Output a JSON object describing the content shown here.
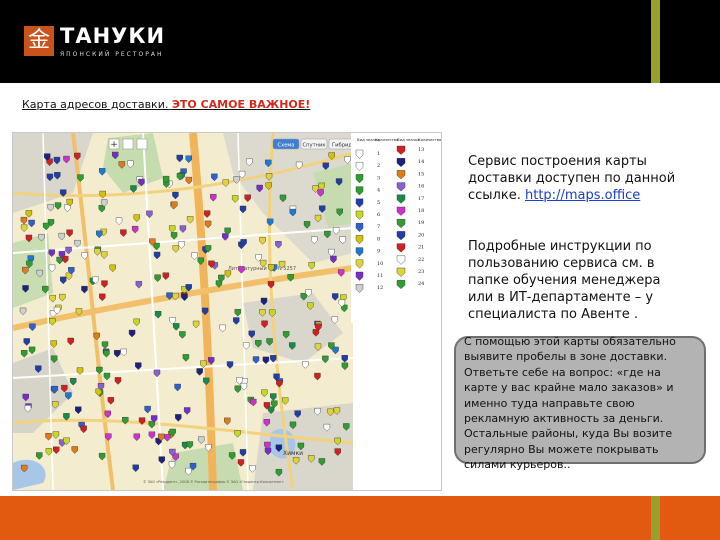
{
  "logo": {
    "name": "ТАНУКИ",
    "subtitle": "ЯПОНСКИЙ РЕСТОРАН",
    "glyph": "金"
  },
  "colors": {
    "header_bg": "#000000",
    "accent_bar": "#97a02a",
    "footer_bar": "#e15a0f",
    "logo_box": "#c9531b",
    "highlight": "#d42a1a",
    "link": "#1a3fc9"
  },
  "caption": {
    "text": "Карта адресов доставки.",
    "highlight": "ЭТО САМОЕ ВАЖНОЕ!"
  },
  "map": {
    "controls": [
      "Схема",
      "Спутник",
      "Гибрид"
    ],
    "legend_headers": [
      "Вид значка",
      "Количество",
      "Вид значка",
      "Количество"
    ],
    "legend_counts_left": [
      "1",
      "2",
      "3",
      "4",
      "5",
      "6",
      "7",
      "8",
      "9",
      "10",
      "11",
      "12"
    ],
    "legend_counts_right": [
      "13",
      "14",
      "15",
      "16",
      "17",
      "18",
      "19",
      "20",
      "21",
      "22",
      "23",
      "24"
    ],
    "street_label": "Литературный пр. N 5257",
    "area_label": "Химки",
    "copyright": "© ЗАО «Резидент», 2008  © Роскартография  © ЗАО «Геоцентр-Консалтинг»"
  },
  "right_text": {
    "para1": "Сервис построения карты доставки доступен по данной ссылке.",
    "link": "http://maps.office",
    "para2": "Подробные инструкции по пользованию сервиса см. в папке обучения менеджера или в ИТ-департаменте – у специалиста по Авенте ."
  },
  "note": {
    "text": "С помощью этой карты обязательно выявите пробелы в зоне доставки. Ответьте себе на вопрос: «где на карте у вас крайне мало заказов» и именно туда направьте свою рекламную активность за деньги. Остальные районы, куда Вы возите регулярно Вы можете покрывать силами курьеров.."
  }
}
